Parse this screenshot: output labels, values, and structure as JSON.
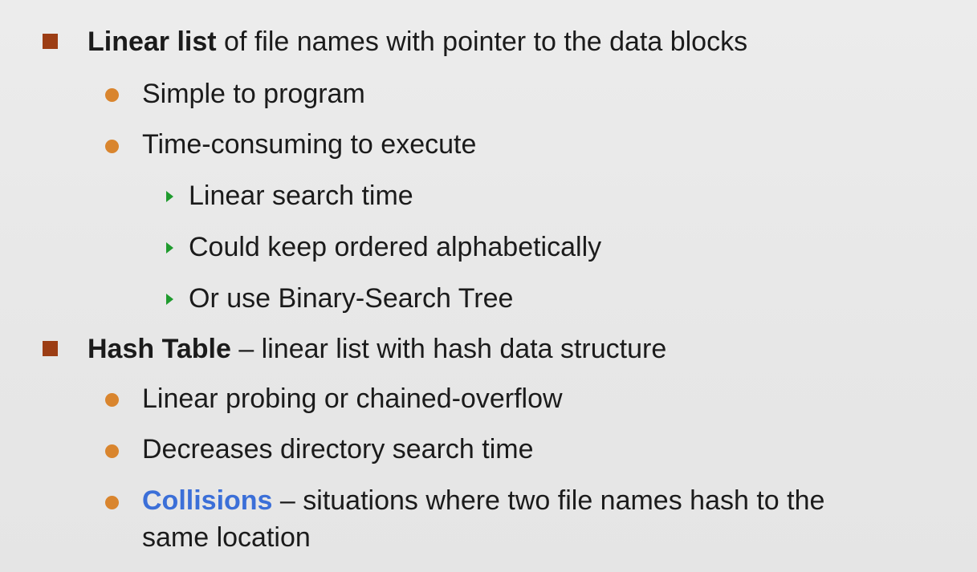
{
  "items": [
    {
      "level": 1,
      "bold": "Linear list",
      "text": " of file names with pointer to the data blocks"
    },
    {
      "level": 2,
      "text": "Simple to program"
    },
    {
      "level": 2,
      "text": "Time-consuming to execute"
    },
    {
      "level": 3,
      "text": "Linear search time"
    },
    {
      "level": 3,
      "text": "Could keep ordered alphabetically"
    },
    {
      "level": 3,
      "text": "Or use Binary-Search Tree"
    },
    {
      "level": 1,
      "bold": "Hash Table",
      "text": " – linear list with hash data structure"
    },
    {
      "level": 2,
      "text": "Linear probing or chained-overflow"
    },
    {
      "level": 2,
      "text": "Decreases directory search time"
    },
    {
      "level": 2,
      "highlight": "Collisions",
      "text": " – situations where two file names hash to the",
      "continuation": "same location"
    }
  ],
  "colors": {
    "level1_bullet": "#9c3d14",
    "level2_bullet": "#d9852e",
    "level3_bullet": "#1f9b2e",
    "highlight": "#3b6fd8"
  }
}
